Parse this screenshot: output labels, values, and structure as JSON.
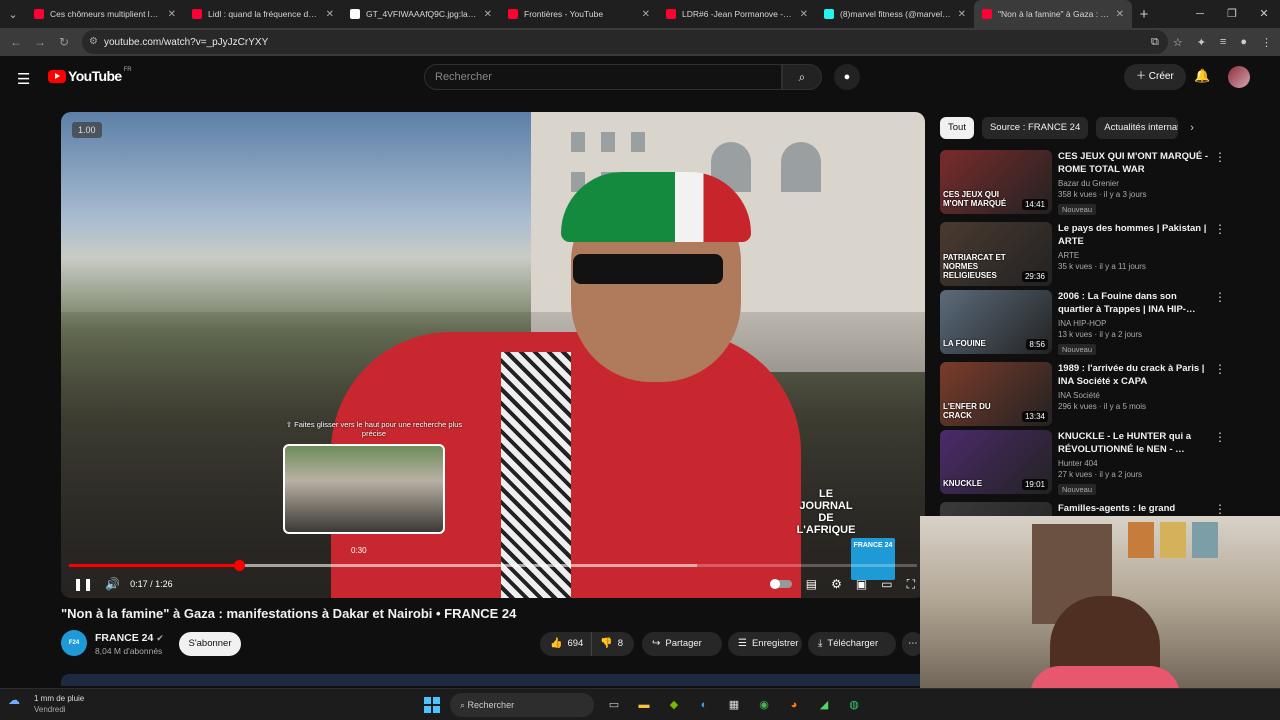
{
  "browser": {
    "tabs": [
      {
        "title": "Ces chômeurs multiplient les c…",
        "color": "#ff0033",
        "active": false
      },
      {
        "title": "Lidl : quand la fréquence de tr…",
        "color": "#ff0033",
        "active": false
      },
      {
        "title": "GT_4VFIWAAAfQ9C.jpg:large (…",
        "color": "#ffffff",
        "active": false
      },
      {
        "title": "Frontières - YouTube",
        "color": "#ff0033",
        "active": false
      },
      {
        "title": "LDR#6 -Jean Pormanove - Enqu…",
        "color": "#ff0033",
        "active": false
      },
      {
        "title": "(8)marvel fitness (@marvel.frt)",
        "color": "#25f4ee",
        "active": false
      },
      {
        "title": "\"Non à la famine\" à Gaza : …",
        "color": "#ff0033",
        "active": true
      }
    ],
    "new_tab": "+",
    "url": "youtube.com/watch?v=_pJyJzCrYXY"
  },
  "youtube": {
    "logo_text": "YouTube",
    "country_code": "FR",
    "search_placeholder": "Rechercher",
    "create_label": "Créer"
  },
  "player": {
    "speed_label": "1.00",
    "time_display": "0:17 / 1:26",
    "progress_fraction": 0.2,
    "buffered_fraction": 0.74,
    "hover_fraction": 0.35,
    "hover_time": "0:30",
    "hover_hint": "⇧ Faites glisser vers le haut pour une recherche plus précise",
    "overlay_logo": "LE JOURNAL DE L'AFRIQUE",
    "overlay_badge": "FRANCE 24"
  },
  "video": {
    "title": "\"Non à la famine\" à Gaza : manifestations à Dakar et Nairobi • FRANCE 24",
    "channel": "FRANCE 24",
    "subscribers": "8,04 M d'abonnés",
    "subscribe_label": "S'abonner",
    "likes": "694",
    "dislikes": "8",
    "share_label": "Partager",
    "save_label": "Enregistrer",
    "download_label": "Télécharger"
  },
  "sidebar": {
    "chips": [
      "Tout",
      "Source : FRANCE 24",
      "Actualités internat"
    ],
    "recommendations": [
      {
        "title": "CES JEUX QUI M'ONT MARQUÉ - ROME TOTAL WAR",
        "channel": "Bazar du Grenier",
        "views": "358 k vues · il y a 3 jours",
        "duration": "14:41",
        "badge": "Nouveau",
        "thumb_text": "CES JEUX QUI M'ONT MARQUÉ",
        "thumb_color": "#7a2b2b"
      },
      {
        "title": "Le pays des hommes | Pakistan | ARTE",
        "channel": "ARTE",
        "views": "35 k vues · il y a 11 jours",
        "duration": "29:36",
        "badge": "",
        "thumb_text": "PATRIARCAT ET NORMES RELIGIEUSES",
        "thumb_color": "#4a3a30"
      },
      {
        "title": "2006 : La Fouine dans son quartier à Trappes | INA HIP-…",
        "channel": "INA HIP-HOP",
        "views": "13 k vues · il y a 2 jours",
        "duration": "8:56",
        "badge": "Nouveau",
        "thumb_text": "LA FOUINE",
        "thumb_color": "#5b6b7b"
      },
      {
        "title": "1989 : l'arrivée du crack à Paris | INA Société x CAPA",
        "channel": "INA Société",
        "views": "296 k vues · il y a 5 mois",
        "duration": "13:34",
        "badge": "",
        "thumb_text": "L'ENFER DU CRACK",
        "thumb_color": "#7b3c2a"
      },
      {
        "title": "KNUCKLE - Le HUNTER qui a RÉVOLUTIONNÉ le NEN - …",
        "channel": "Hunter 404",
        "views": "27 k vues · il y a 2 jours",
        "duration": "19:01",
        "badge": "Nouveau",
        "thumb_text": "KNUCKLE",
        "thumb_color": "#4b2a6b"
      },
      {
        "title": "Familles-agents : le grand",
        "channel": "",
        "views": "",
        "duration": "",
        "badge": "",
        "thumb_text": "",
        "thumb_color": "#3a3a3a"
      }
    ]
  },
  "taskbar": {
    "weather_temp": "1 mm de pluie",
    "weather_day": "Vendredi",
    "search_label": "Rechercher"
  }
}
